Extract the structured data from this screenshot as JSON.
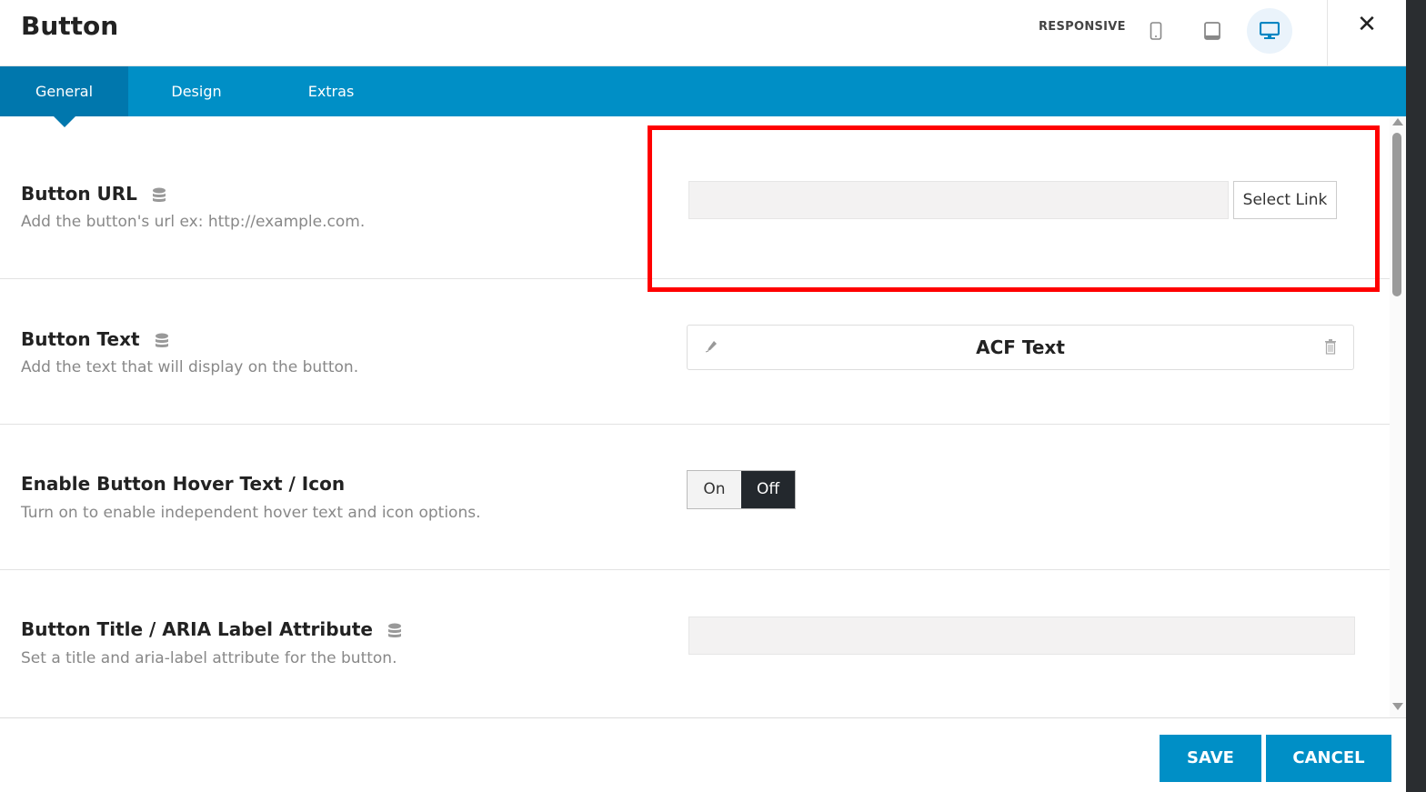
{
  "header": {
    "title": "Button",
    "responsive_label": "RESPONSIVE",
    "devices": [
      "mobile-icon",
      "tablet-icon",
      "desktop-icon"
    ],
    "active_device": "desktop"
  },
  "tabs": [
    {
      "label": "General",
      "active": true
    },
    {
      "label": "Design"
    },
    {
      "label": "Extras"
    }
  ],
  "fields": [
    {
      "label": "Button URL",
      "description": "Add the button's url ex: http://example.com.",
      "value": "",
      "button": "Select Link"
    },
    {
      "label": "Button Text",
      "description": "Add the text that will display on the button.",
      "value": "ACF Text"
    },
    {
      "label": "Enable Button Hover Text / Icon",
      "description": "Turn on to enable independent hover text and icon options.",
      "options": [
        "On",
        "Off"
      ],
      "selected": "Off"
    },
    {
      "label": "Button Title / ARIA Label Attribute",
      "description": "Set a title and aria-label attribute for the button.",
      "value": ""
    }
  ],
  "footer": {
    "save": "SAVE",
    "cancel": "CANCEL"
  },
  "colors": {
    "accent": "#008fc6",
    "active_tab": "#0077ad",
    "highlight": "#ff0000"
  }
}
